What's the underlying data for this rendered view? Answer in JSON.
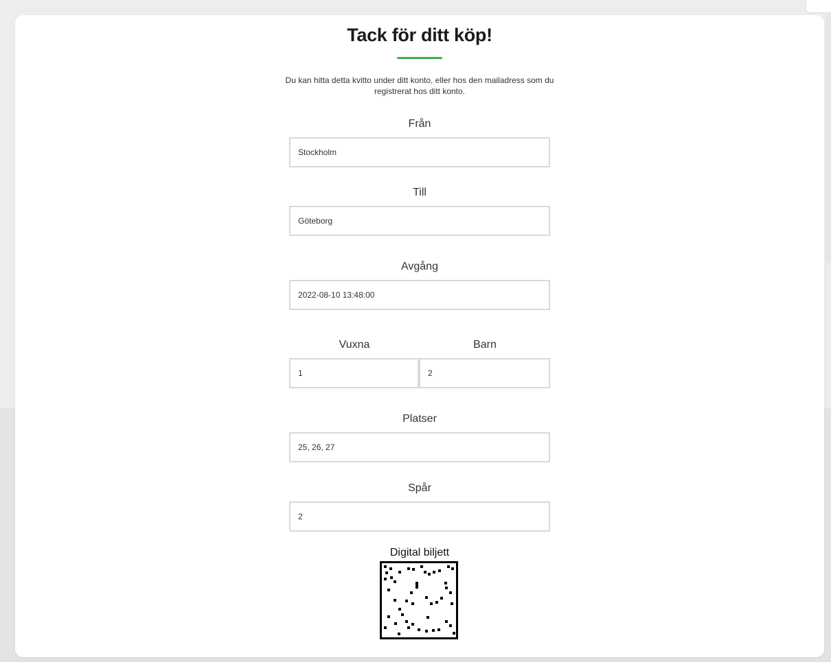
{
  "page": {
    "title": "Tack för ditt köp!",
    "intro": "Du kan hitta detta kvitto under ditt konto, eller hos den mailadress som du registrerat hos ditt konto."
  },
  "fields": {
    "from": {
      "label": "Från",
      "value": "Stockholm"
    },
    "to": {
      "label": "Till",
      "value": "Göteborg"
    },
    "departure": {
      "label": "Avgång",
      "value": "2022-08-10 13:48:00"
    },
    "adults": {
      "label": "Vuxna",
      "value": "1"
    },
    "children": {
      "label": "Barn",
      "value": "2"
    },
    "seats": {
      "label": "Platser",
      "value": "25, 26, 27"
    },
    "track": {
      "label": "Spår",
      "value": "2"
    }
  },
  "ticket": {
    "label": "Digital biljett",
    "icon": "qr-code-icon"
  },
  "colors": {
    "accent": "#35b54a",
    "field_border": "#d9d9d9"
  }
}
